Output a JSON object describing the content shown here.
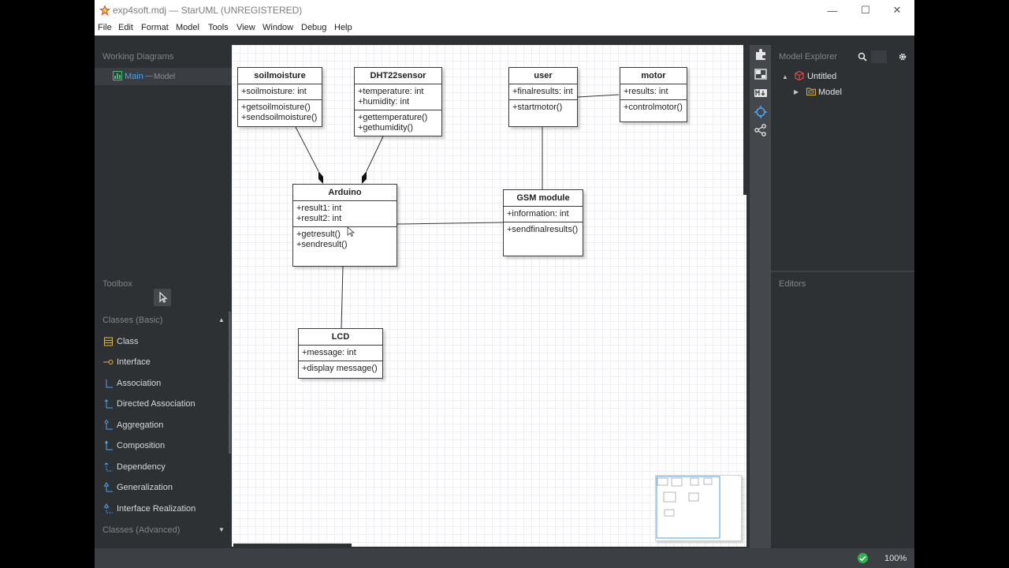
{
  "window": {
    "title": "exp4soft.mdj — StarUML (UNREGISTERED)",
    "controls": {
      "minimize": "—",
      "maximize": "☐",
      "close": "✕"
    }
  },
  "menu": [
    "File",
    "Edit",
    "Format",
    "Model",
    "Tools",
    "View",
    "Window",
    "Debug",
    "Help"
  ],
  "working_diagrams": {
    "title": "Working Diagrams",
    "item": {
      "name": "Main",
      "dash": "—",
      "context": "Model"
    }
  },
  "toolbox": {
    "title": "Toolbox",
    "group_basic": "Classes (Basic)",
    "group_advanced": "Classes (Advanced)",
    "tools": [
      "Class",
      "Interface",
      "Association",
      "Directed Association",
      "Aggregation",
      "Composition",
      "Dependency",
      "Generalization",
      "Interface Realization"
    ]
  },
  "diagram": {
    "classes": [
      {
        "name": "soilmoisture",
        "attrs": [
          "+soilmoisture: int"
        ],
        "ops": [
          "+getsoilmoisture()",
          "+sendsoilmoisture()"
        ]
      },
      {
        "name": "DHT22sensor",
        "attrs": [
          "+temperature: int",
          "+humidity: int"
        ],
        "ops": [
          "+gettemperature()",
          "+gethumidity()"
        ]
      },
      {
        "name": "user",
        "attrs": [
          "+finalresults: int"
        ],
        "ops": [
          "+startmotor()"
        ]
      },
      {
        "name": "motor",
        "attrs": [
          "+results: int"
        ],
        "ops": [
          "+controlmotor()"
        ]
      },
      {
        "name": "Arduino",
        "attrs": [
          "+result1: int",
          "+result2: int"
        ],
        "ops": [
          "+getresult()",
          "+sendresult()"
        ]
      },
      {
        "name": "GSM module",
        "attrs": [
          "+information: int"
        ],
        "ops": [
          "+sendfinalresults()"
        ]
      },
      {
        "name": "LCD",
        "attrs": [
          "+message: int"
        ],
        "ops": [
          "+display message()"
        ]
      }
    ]
  },
  "model_explorer": {
    "title": "Model Explorer",
    "root": "Untitled",
    "child": "Model"
  },
  "editors": {
    "title": "Editors"
  },
  "status": {
    "zoom": "100%"
  },
  "colors": {
    "accent": "#4ba3f0",
    "ok": "#2eb54a",
    "root_icon": "#e84a4a",
    "folder_icon": "#d9b24c"
  }
}
